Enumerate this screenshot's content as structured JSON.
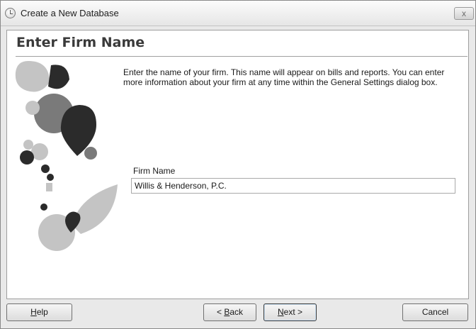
{
  "window": {
    "title": "Create a New Database",
    "close_label": "x"
  },
  "page": {
    "title": "Enter Firm Name",
    "description": "Enter the name of your firm. This name will appear on bills and reports. You can enter more information about your firm at any time within the General Settings dialog box."
  },
  "form": {
    "firm_name_label": "Firm Name",
    "firm_name_value": "Willis & Henderson, P.C."
  },
  "buttons": {
    "help": {
      "key": "H",
      "rest": "elp"
    },
    "back": {
      "prefix": "< ",
      "key": "B",
      "rest": "ack"
    },
    "next": {
      "key": "N",
      "rest": "ext >"
    },
    "cancel": "Cancel"
  },
  "colors": {
    "window_bg": "#e9e9e9",
    "panel_bg": "#ffffff",
    "art_dark": "#2b2b2b",
    "art_mid": "#7a7a7a",
    "art_light": "#c4c4c4"
  }
}
